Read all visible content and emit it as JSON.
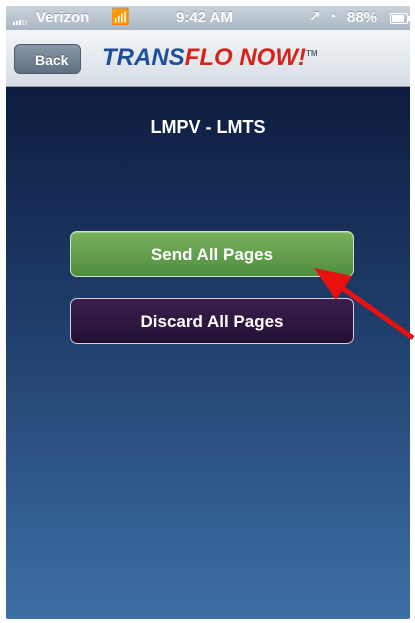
{
  "status_bar": {
    "carrier": "Verizon",
    "time": "9:42 AM",
    "battery": "88%"
  },
  "nav": {
    "back_label": "Back",
    "logo_part1": "TRANS",
    "logo_part2": "FLO NOW!",
    "logo_tm": "TM"
  },
  "main": {
    "title": "LMPV - LMTS",
    "send_label": "Send All Pages",
    "discard_label": "Discard All Pages"
  },
  "colors": {
    "send_button": "#5f9e4a",
    "discard_button": "#2e1840",
    "background_top": "#0e1c3f",
    "background_bottom": "#3d6fa4",
    "annotation_arrow": "#e8110d"
  }
}
